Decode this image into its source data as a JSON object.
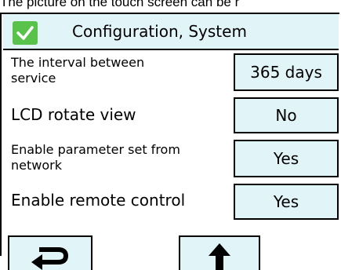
{
  "caption": "The picture on the touch screen can be r",
  "header": {
    "title": "Configuration, System",
    "icon": "checkmark-icon",
    "accent": "#58c24b"
  },
  "rows": [
    {
      "label_line1": "The interval between",
      "label_line2": "service",
      "value": "365 days"
    },
    {
      "label": "LCD rotate view",
      "value": "No"
    },
    {
      "label_line1": "Enable parameter set from",
      "label_line2": "network",
      "value": "Yes"
    },
    {
      "label": "Enable remote control",
      "value": "Yes"
    }
  ],
  "nav": {
    "back_icon": "return-arrow-icon",
    "up_icon": "up-arrow-icon"
  },
  "colors": {
    "button_bg": "#e1f4f7",
    "border": "#000000"
  }
}
